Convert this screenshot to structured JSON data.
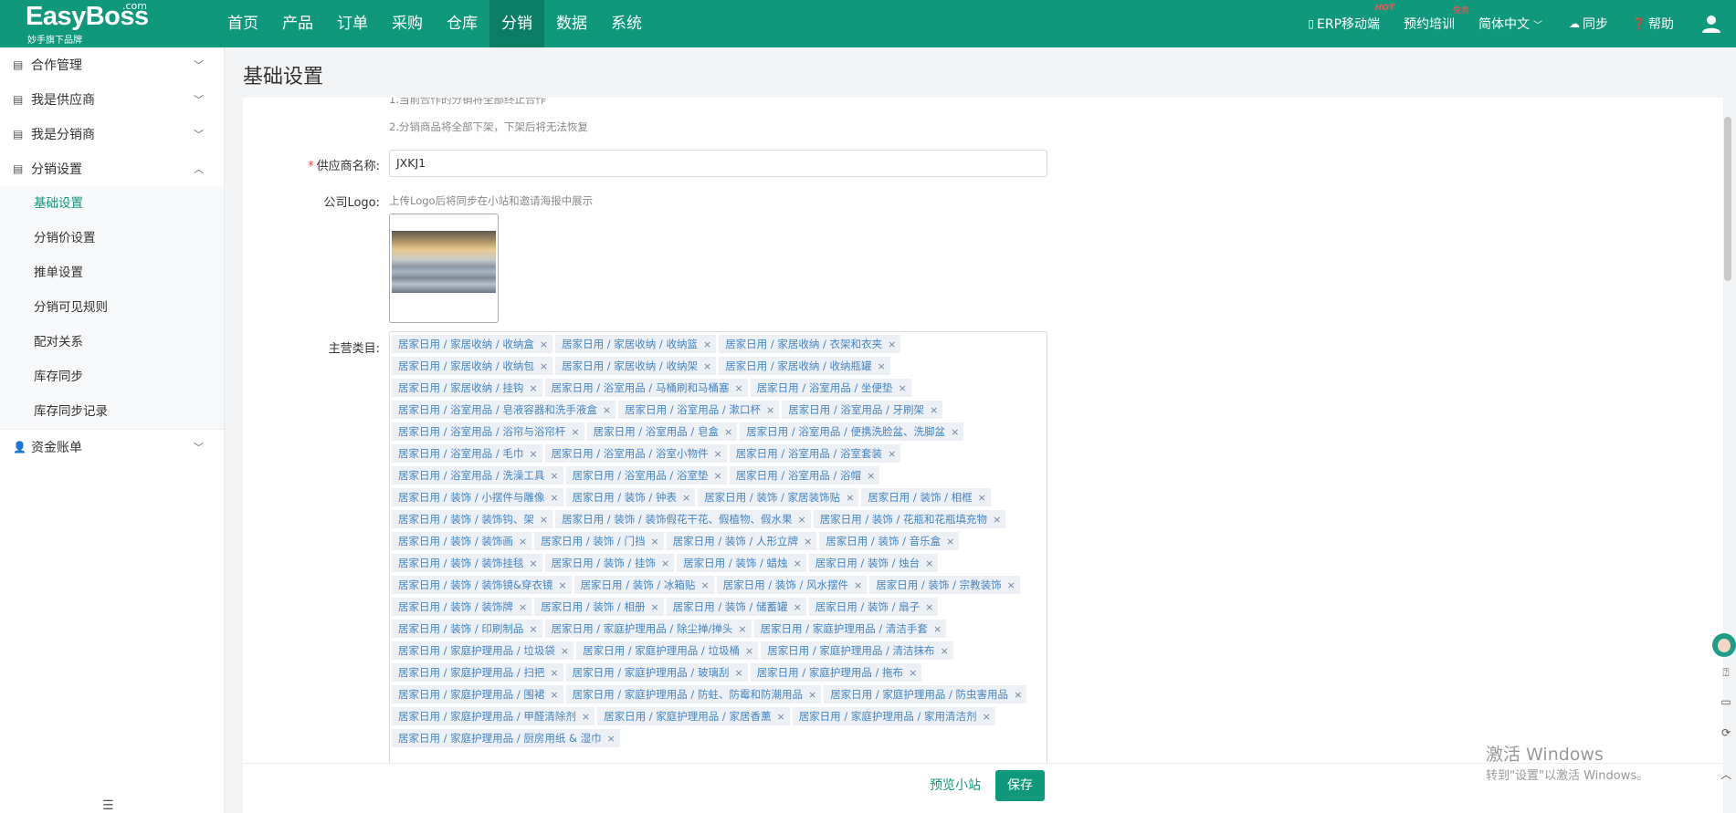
{
  "brand": {
    "name": "EasyBoss",
    "dotcom": ".com",
    "subtitle": "妙手旗下品牌"
  },
  "nav": {
    "items": [
      "首页",
      "产品",
      "订单",
      "采购",
      "仓库",
      "分销",
      "数据",
      "系统"
    ],
    "active": "分销"
  },
  "topright": {
    "mobile": "ERP移动端",
    "mobile_badge": "HOT",
    "training": "预约培训",
    "training_badge": "免费",
    "language": "简体中文",
    "sync": "同步",
    "help": "帮助"
  },
  "sidebar": {
    "groups": [
      {
        "label": "合作管理"
      },
      {
        "label": "我是供应商"
      },
      {
        "label": "我是分销商"
      },
      {
        "label": "分销设置"
      },
      {
        "label": "资金账单"
      }
    ],
    "sub_items": [
      "基础设置",
      "分销价设置",
      "推单设置",
      "分销可见规则",
      "配对关系",
      "库存同步",
      "库存同步记录"
    ],
    "active_sub": "基础设置"
  },
  "page": {
    "title": "基础设置",
    "hint1": "1.当前合作的分销将全部终止合作",
    "hint2": "2.分销商品将全部下架，下架后将无法恢复",
    "supplier_label": "供应商名称:",
    "supplier_value": "JXKJ1",
    "logo_label": "公司Logo:",
    "logo_tip": "上传Logo后将同步在小站和邀请海报中展示",
    "category_label": "主营类目:",
    "categories": [
      "居家日用 / 家居收纳 / 收纳盒",
      "居家日用 / 家居收纳 / 收纳篮",
      "居家日用 / 家居收纳 / 衣架和衣夹",
      "居家日用 / 家居收纳 / 收纳包",
      "居家日用 / 家居收纳 / 收纳架",
      "居家日用 / 家居收纳 / 收纳瓶罐",
      "居家日用 / 家居收纳 / 挂钩",
      "居家日用 / 浴室用品 / 马桶刷和马桶塞",
      "居家日用 / 浴室用品 / 坐便垫",
      "居家日用 / 浴室用品 / 皂液容器和洗手液盒",
      "居家日用 / 浴室用品 / 漱口杯",
      "居家日用 / 浴室用品 / 牙刷架",
      "居家日用 / 浴室用品 / 浴帘与浴帘杆",
      "居家日用 / 浴室用品 / 皂盒",
      "居家日用 / 浴室用品 / 便携洗脸盆、洗脚盆",
      "居家日用 / 浴室用品 / 毛巾",
      "居家日用 / 浴室用品 / 浴室小物件",
      "居家日用 / 浴室用品 / 浴室套装",
      "居家日用 / 浴室用品 / 洗澡工具",
      "居家日用 / 浴室用品 / 浴室垫",
      "居家日用 / 浴室用品 / 浴帽",
      "居家日用 / 装饰 / 小摆件与雕像",
      "居家日用 / 装饰 / 钟表",
      "居家日用 / 装饰 / 家居装饰贴",
      "居家日用 / 装饰 / 相框",
      "居家日用 / 装饰 / 装饰钩、架",
      "居家日用 / 装饰 / 装饰假花干花、假植物、假水果",
      "居家日用 / 装饰 / 花瓶和花瓶填充物",
      "居家日用 / 装饰 / 装饰画",
      "居家日用 / 装饰 / 门挡",
      "居家日用 / 装饰 / 人形立牌",
      "居家日用 / 装饰 / 音乐盒",
      "居家日用 / 装饰 / 装饰挂毯",
      "居家日用 / 装饰 / 挂饰",
      "居家日用 / 装饰 / 蜡烛",
      "居家日用 / 装饰 / 烛台",
      "居家日用 / 装饰 / 装饰镜&穿衣镜",
      "居家日用 / 装饰 / 冰箱贴",
      "居家日用 / 装饰 / 风水摆件",
      "居家日用 / 装饰 / 宗教装饰",
      "居家日用 / 装饰 / 装饰牌",
      "居家日用 / 装饰 / 相册",
      "居家日用 / 装饰 / 储蓄罐",
      "居家日用 / 装饰 / 扇子",
      "居家日用 / 装饰 / 印刷制品",
      "居家日用 / 家庭护理用品 / 除尘掸/掸头",
      "居家日用 / 家庭护理用品 / 清洁手套",
      "居家日用 / 家庭护理用品 / 垃圾袋",
      "居家日用 / 家庭护理用品 / 垃圾桶",
      "居家日用 / 家庭护理用品 / 清洁抹布",
      "居家日用 / 家庭护理用品 / 扫把",
      "居家日用 / 家庭护理用品 / 玻璃刮",
      "居家日用 / 家庭护理用品 / 拖布",
      "居家日用 / 家庭护理用品 / 围裙",
      "居家日用 / 家庭护理用品 / 防蛀、防霉和防潮用品",
      "居家日用 / 家庭护理用品 / 防虫害用品",
      "居家日用 / 家庭护理用品 / 甲醛清除剂",
      "居家日用 / 家庭护理用品 / 家居香薰",
      "居家日用 / 家庭护理用品 / 家用清洁剂",
      "居家日用 / 家庭护理用品 / 厨房用纸 & 湿巾"
    ]
  },
  "bottom": {
    "preview": "预览小站",
    "save": "保存"
  },
  "watermark": {
    "line1": "激活 Windows",
    "line2": "转到\"设置\"以激活 Windows。"
  },
  "colors": {
    "primary": "#10987d",
    "tag_bg": "#edf1f6",
    "tag_text": "#4285c4"
  }
}
